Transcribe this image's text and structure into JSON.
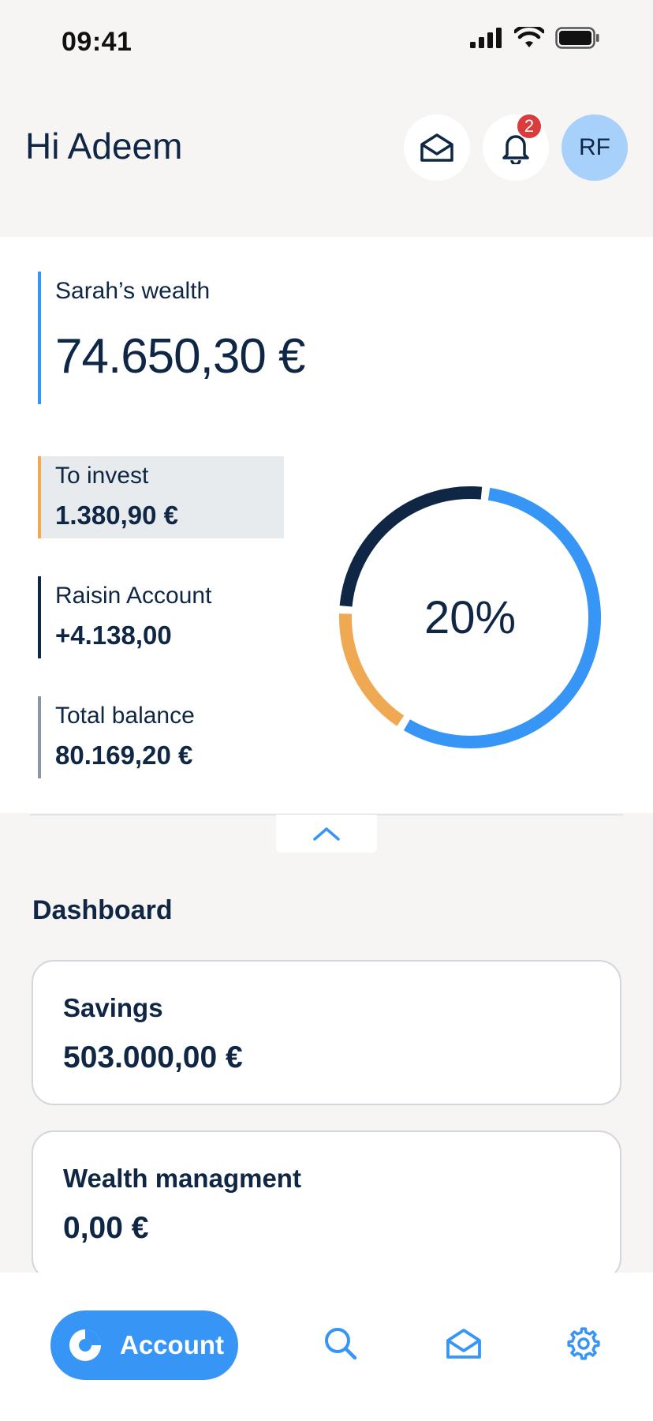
{
  "status_bar": {
    "time": "09:41"
  },
  "header": {
    "greeting": "Hi Adeem",
    "notification_count": "2",
    "avatar_initials": "RF"
  },
  "wealth": {
    "label": "Sarah’s wealth",
    "amount": "74.650,30 €",
    "legend": [
      {
        "label": "To invest",
        "value": "1.380,90 €",
        "color": "#efa953"
      },
      {
        "label": "Raisin Account",
        "value": "+4.138,00",
        "color": "#0f2744"
      },
      {
        "label": "Total balance",
        "value": "80.169,20 €",
        "color": "#8d96a5"
      }
    ],
    "donut": {
      "center_label": "20%",
      "segments": [
        {
          "name": "blue",
          "fraction": 0.57,
          "color": "#3695f5"
        },
        {
          "name": "orange",
          "fraction": 0.17,
          "color": "#efa953"
        },
        {
          "name": "navy",
          "fraction": 0.26,
          "color": "#0f2744"
        }
      ]
    }
  },
  "dashboard": {
    "title": "Dashboard",
    "cards": [
      {
        "label": "Savings",
        "value": "503.000,00 €"
      },
      {
        "label": "Wealth managment",
        "value": "0,00 €"
      }
    ]
  },
  "nav": {
    "account_label": "Account",
    "accent_color": "#3695f5"
  }
}
